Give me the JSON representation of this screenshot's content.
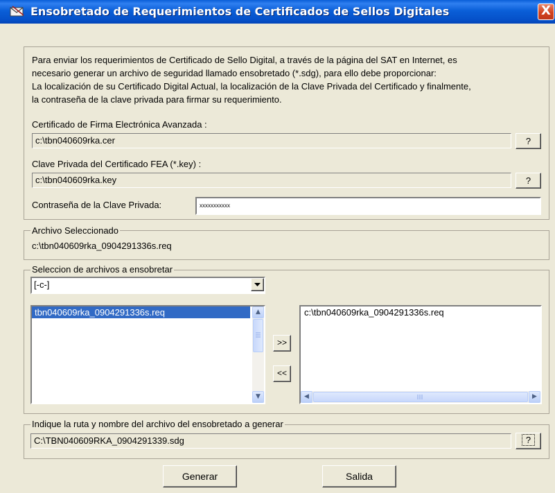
{
  "window": {
    "title": "Ensobretado de Requerimientos de Certificados de Sellos Digitales",
    "close_glyph": "X"
  },
  "intro": {
    "line1": "Para enviar  los requerimientos  de Certificado de Sello  Digital, a través de la página del SAT en  Internet, es",
    "line2": "necesario generar un archivo de seguridad llamado ensobretado (*.sdg),  para ello debe proporcionar:",
    "line3": "La localización de su Certificado Digital Actual, la localización de la Clave Privada  del Certificado y finalmente,",
    "line4": "la contraseña de la clave privada para firmar su requerimiento."
  },
  "certificate": {
    "label": "Certificado de Firma Electrónica Avanzada :",
    "value": "c:\\tbn040609rka.cer",
    "browse_label": "?"
  },
  "private_key": {
    "label": "Clave Privada del Certificado FEA (*.key) :",
    "value": "c:\\tbn040609rka.key",
    "browse_label": "?"
  },
  "password": {
    "label": "Contraseña de la Clave Privada:",
    "value": "xxxxxxxxxxx"
  },
  "selected_file": {
    "legend": "Archivo Seleccionado",
    "value": "c:\\tbn040609rka_0904291336s.req"
  },
  "file_selection": {
    "legend": "Seleccion de archivos a ensobretar",
    "drive_value": "[-c-]",
    "available_files": [
      "tbn040609rka_0904291336s.req"
    ],
    "chosen_files": [
      "c:\\tbn040609rka_0904291336s.req"
    ],
    "add_label": ">>",
    "remove_label": "<<"
  },
  "output": {
    "legend": "Indique la ruta y nombre del archivo del ensobretado a generar",
    "value": "C:\\TBN040609RKA_0904291339.sdg",
    "browse_label": "?"
  },
  "actions": {
    "generate_label": "Generar",
    "exit_label": "Salida"
  },
  "colors": {
    "titlebar": "#0a5fd8",
    "window_bg": "#ece9d8",
    "selection": "#316ac5",
    "close_button": "#d2421e"
  }
}
